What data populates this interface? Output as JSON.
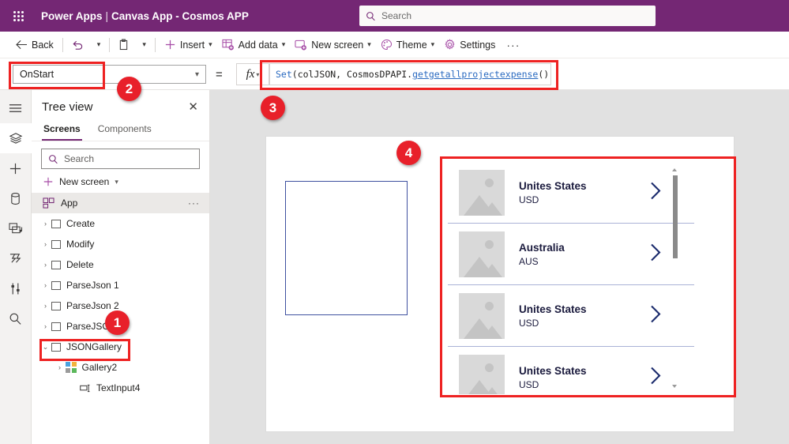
{
  "header": {
    "brand": "Power Apps",
    "separator": "|",
    "subtitle": "Canvas App - Cosmos APP",
    "search_placeholder": "Search",
    "bg_color": "#742774"
  },
  "toolbar": {
    "back": "Back",
    "insert": "Insert",
    "add_data": "Add data",
    "new_screen": "New screen",
    "theme": "Theme",
    "settings": "Settings",
    "overflow": "···"
  },
  "formula_bar": {
    "property": "OnStart",
    "equals": "=",
    "fx": "fx",
    "formula_parts": [
      {
        "text": "Set",
        "style": "fn"
      },
      {
        "text": "(colJSON, CosmosDPAPI.",
        "style": "plain"
      },
      {
        "text": "getgetallprojectexpense",
        "style": "link"
      },
      {
        "text": "())",
        "style": "plain"
      }
    ],
    "formula_full": "Set(colJSON, CosmosDPAPI.getgetallprojectexpense())"
  },
  "rail": {
    "items": [
      {
        "icon": "hamburger-menu-icon",
        "active": false
      },
      {
        "icon": "tree-view-layers-icon",
        "active": true
      },
      {
        "icon": "insert-plus-icon",
        "active": false
      },
      {
        "icon": "data-cylinder-icon",
        "active": false
      },
      {
        "icon": "media-icon",
        "active": false
      },
      {
        "icon": "power-automate-icon",
        "active": false
      },
      {
        "icon": "variables-icon",
        "active": false
      },
      {
        "icon": "search-icon",
        "active": false
      }
    ]
  },
  "tree_view": {
    "title": "Tree view",
    "close": "✕",
    "tabs": [
      {
        "label": "Screens",
        "selected": true
      },
      {
        "label": "Components",
        "selected": false
      }
    ],
    "search_placeholder": "Search",
    "new_screen": "New screen",
    "app_row": {
      "label": "App",
      "dots": "···"
    },
    "nodes": [
      {
        "label": "Create",
        "level": 0,
        "expander": "›",
        "icon": "screen-icon",
        "expanded": false,
        "highlighted": false
      },
      {
        "label": "Modify",
        "level": 0,
        "expander": "›",
        "icon": "screen-icon",
        "expanded": false,
        "highlighted": false
      },
      {
        "label": "Delete",
        "level": 0,
        "expander": "›",
        "icon": "screen-icon",
        "expanded": false,
        "highlighted": false
      },
      {
        "label": "ParseJson 1",
        "level": 0,
        "expander": "›",
        "icon": "screen-icon",
        "expanded": false,
        "highlighted": false
      },
      {
        "label": "ParseJson 2",
        "level": 0,
        "expander": "›",
        "icon": "screen-icon",
        "expanded": false,
        "highlighted": false
      },
      {
        "label": "ParseJSON",
        "level": 0,
        "expander": "›",
        "icon": "screen-icon",
        "expanded": false,
        "highlighted": false
      },
      {
        "label": "JSONGallery",
        "level": 0,
        "expander": "⌄",
        "icon": "screen-icon",
        "expanded": true,
        "highlighted": false
      },
      {
        "label": "Gallery2",
        "level": 1,
        "expander": "›",
        "icon": "gallery-icon",
        "expanded": false,
        "highlighted": true
      },
      {
        "label": "TextInput4",
        "level": 2,
        "expander": "",
        "icon": "text-input-icon",
        "expanded": false,
        "highlighted": false
      }
    ]
  },
  "canvas": {
    "text_input": {
      "name": "TextInput4",
      "value": "",
      "border_color": "#3f51a0"
    },
    "gallery": {
      "name": "Gallery2",
      "items": [
        {
          "title": "Unites States",
          "subtitle": "USD",
          "chevron": "›"
        },
        {
          "title": "Australia",
          "subtitle": "AUS",
          "chevron": "›"
        },
        {
          "title": "Unites States",
          "subtitle": "USD",
          "chevron": "›"
        },
        {
          "title": "Unites States",
          "subtitle": "USD",
          "chevron": "›"
        }
      ]
    }
  },
  "annotations": [
    {
      "number": "1",
      "target": "tree-node-gallery2"
    },
    {
      "number": "2",
      "target": "property-selector"
    },
    {
      "number": "3",
      "target": "formula-field"
    },
    {
      "number": "4",
      "target": "gallery-control"
    }
  ]
}
